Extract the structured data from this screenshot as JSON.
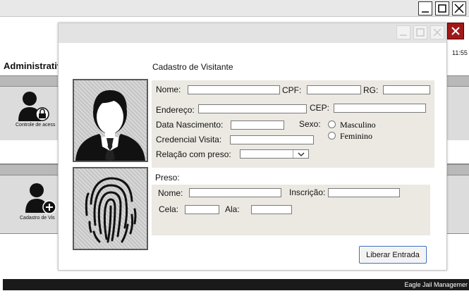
{
  "background": {
    "header_title": "Administrativ",
    "clock": "11:55",
    "module_access_label": "Controle de acess",
    "module_visitor_label": "Cadastro de Vis",
    "footer_text": "Eagle Jail Managemer"
  },
  "modal": {
    "title": "Cadastro de Visitante",
    "visitor": {
      "name_label": "Nome:",
      "cpf_label": "CPF:",
      "rg_label": "RG:",
      "address_label": "Endereço:",
      "cep_label": "CEP:",
      "birth_label": "Data Nascimento:",
      "sex_label": "Sexo:",
      "sex_options": [
        "Masculino",
        "Feminino"
      ],
      "credential_label": "Credencial Visita:",
      "relation_label": "Relação com preso:",
      "relation_value": ""
    },
    "prisoner": {
      "section_label": "Preso:",
      "name_label": "Nome:",
      "inscricao_label": "Inscrição:",
      "cela_label": "Cela:",
      "ala_label": "Ala:"
    },
    "submit_label": "Liberar Entrada"
  },
  "colors": {
    "close_button": "#a01818",
    "panel_bg": "#ece9e3",
    "button_border": "#3b6bb5"
  }
}
